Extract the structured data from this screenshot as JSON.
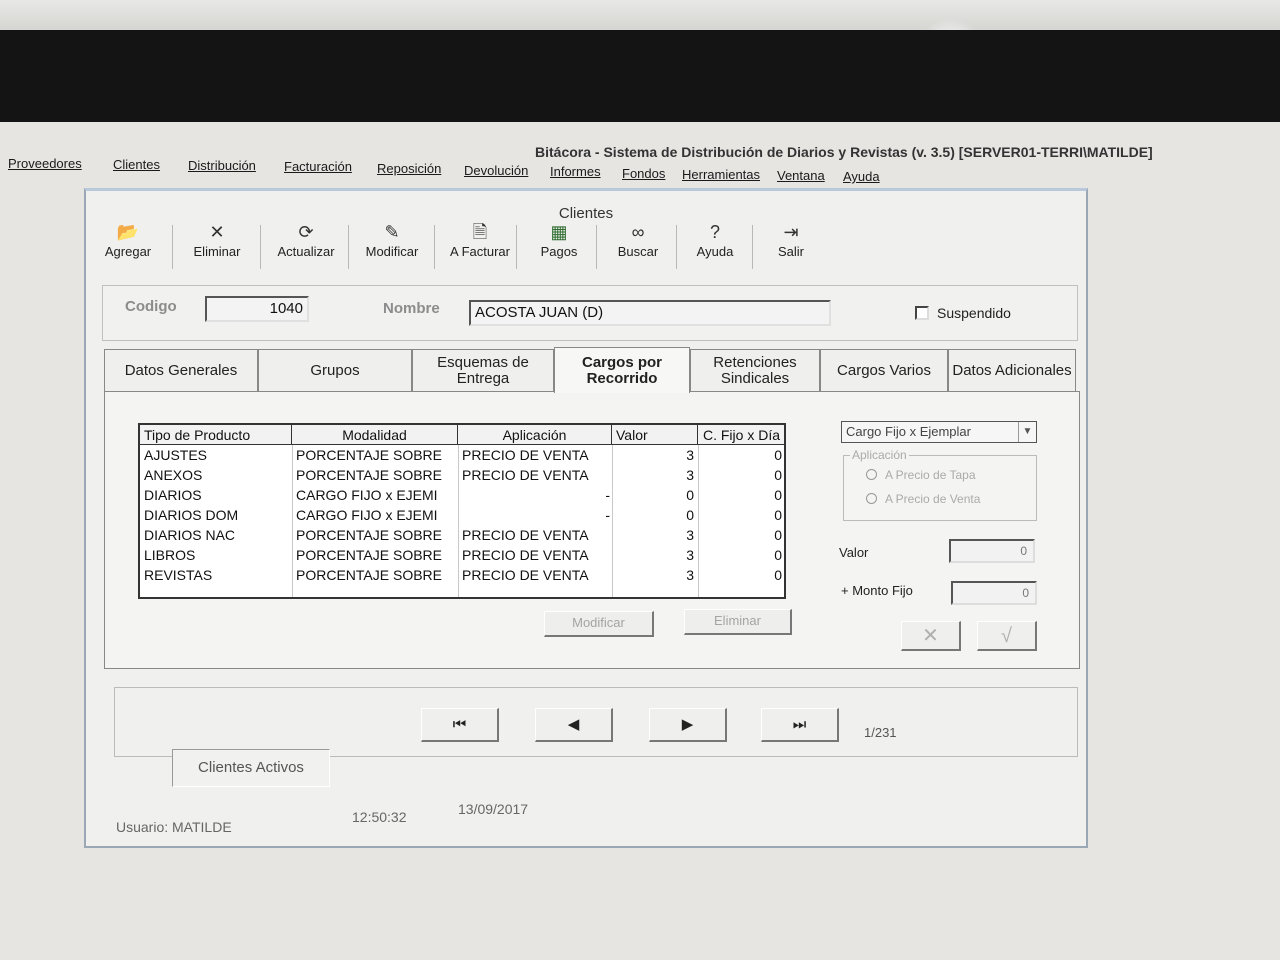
{
  "app": {
    "title": "Bitácora - Sistema de Distribución de Diarios y Revistas (v. 3.5) [SERVER01-TERRI\\MATILDE]"
  },
  "menu": [
    "Proveedores",
    "Clientes",
    "Distribución",
    "Facturación",
    "Reposición",
    "Devolución",
    "Informes",
    "Fondos",
    "Herramientas",
    "Ventana",
    "Ayuda"
  ],
  "window": {
    "title": "Clientes"
  },
  "toolbar": [
    {
      "label": "Agregar",
      "icon": "folder-open-icon"
    },
    {
      "label": "Eliminar",
      "icon": "close-icon"
    },
    {
      "label": "Actualizar",
      "icon": "refresh-icon"
    },
    {
      "label": "Modificar",
      "icon": "edit-icon"
    },
    {
      "label": "A Facturar",
      "icon": "invoice-icon"
    },
    {
      "label": "Pagos",
      "icon": "cash-icon"
    },
    {
      "label": "Buscar",
      "icon": "binoculars-icon"
    },
    {
      "label": "Ayuda",
      "icon": "help-icon"
    },
    {
      "label": "Salir",
      "icon": "exit-icon"
    }
  ],
  "client": {
    "codigo_label": "Codigo",
    "codigo": "1040",
    "nombre_label": "Nombre",
    "nombre": "ACOSTA JUAN (D)",
    "suspendido_label": "Suspendido",
    "suspendido": false
  },
  "tabs": [
    {
      "label": "Datos Generales"
    },
    {
      "label": "Grupos"
    },
    {
      "label": "Esquemas de Entrega"
    },
    {
      "label": "Cargos por Recorrido",
      "active": true
    },
    {
      "label": "Retenciones Sindicales"
    },
    {
      "label": "Cargos Varios"
    },
    {
      "label": "Datos Adicionales"
    }
  ],
  "grid": {
    "columns": [
      "Tipo de Producto",
      "Modalidad",
      "Aplicación",
      "Valor",
      "C. Fijo x Día"
    ],
    "rows": [
      [
        "AJUSTES",
        "PORCENTAJE SOBRE",
        "PRECIO DE VENTA",
        "3",
        "0"
      ],
      [
        "ANEXOS",
        "PORCENTAJE SOBRE",
        "PRECIO DE VENTA",
        "3",
        "0"
      ],
      [
        "DIARIOS",
        "CARGO FIJO x EJEMI",
        "-",
        "0",
        "0"
      ],
      [
        "DIARIOS DOM",
        "CARGO FIJO x EJEMI",
        "-",
        "0",
        "0"
      ],
      [
        "DIARIOS NAC",
        "PORCENTAJE SOBRE",
        "PRECIO DE VENTA",
        "3",
        "0"
      ],
      [
        "LIBROS",
        "PORCENTAJE SOBRE",
        "PRECIO DE VENTA",
        "3",
        "0"
      ],
      [
        "REVISTAS",
        "PORCENTAJE SOBRE",
        "PRECIO DE VENTA",
        "3",
        "0"
      ]
    ]
  },
  "grid_buttons": {
    "modificar": "Modificar",
    "eliminar": "Eliminar"
  },
  "side": {
    "combo_value": "Cargo Fijo x Ejemplar",
    "aplicacion_label": "Aplicación",
    "radio_tapa": "A Precio de Tapa",
    "radio_venta": "A Precio de Venta",
    "valor_label": "Valor",
    "valor": "0",
    "monto_label": "+ Monto Fijo",
    "monto": "0",
    "cancel_glyph": "✕",
    "ok_glyph": "√"
  },
  "nav": {
    "first": "⏮",
    "prev": "◀",
    "next": "▶",
    "last": "⏭",
    "counter": "1/231",
    "filter": "Clientes Activos"
  },
  "status": {
    "usuario": "Usuario: MATILDE",
    "hora": "12:50:32",
    "fecha": "13/09/2017"
  }
}
